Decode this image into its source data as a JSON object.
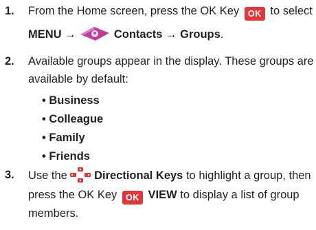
{
  "steps": [
    {
      "number": "1.",
      "line1_text": "From the Home screen, press the OK Key",
      "ok_key_label": "OK",
      "line1_after": "to select",
      "menu_label": "MENU →",
      "contacts_groups_label": "Contacts → Groups",
      "period": "."
    },
    {
      "number": "2.",
      "line1": "Available groups appear in the display. These groups are",
      "line2": "available by default:",
      "groups": [
        "Business",
        "Colleague",
        "Family",
        "Friends"
      ]
    },
    {
      "number": "3.",
      "line1_before": "Use the",
      "directional_keys_label": "Directional Keys",
      "line1_after": "to highlight a group, then",
      "line2_before": "press the OK Key",
      "ok_key_label": "OK",
      "view_label": "VIEW",
      "line2_after": "to display a list of group",
      "line3": "members."
    }
  ],
  "bullet_char": "•",
  "colors": {
    "ok_key": "#e2373a",
    "menu_icon": "#c13a9a",
    "text": "#231f20"
  }
}
